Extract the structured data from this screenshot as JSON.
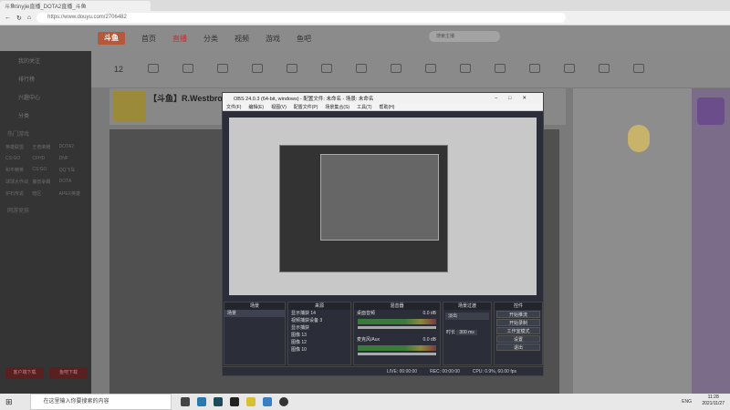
{
  "browser": {
    "tab_active": "斗鱼tinyjie直播_DOTA2直播_斗鱼",
    "url": "https://www.douyu.com/2706482"
  },
  "site": {
    "logo": "斗鱼",
    "nav": [
      "首页",
      "直播",
      "分类",
      "视频",
      "游戏",
      "鱼吧"
    ],
    "search_placeholder": "搜索主播"
  },
  "sidebar": {
    "items": [
      "我的关注",
      "排行榜",
      "兴趣中心",
      "分类"
    ],
    "section1": "热门游戏",
    "games": [
      "英雄联盟",
      "王者荣耀",
      "DOTA2",
      "CS:GO",
      "CFHD",
      "DNF",
      "和平精英",
      "CS:GO",
      "QQ飞车",
      "球球大作战",
      "魔兽争霸",
      "DOTA",
      "炉石传说",
      "暗区",
      "APEX英雄"
    ],
    "section2": "网游竞技",
    "buttons": [
      "客户端下载",
      "鱼吧下载"
    ]
  },
  "room": {
    "streamer": "【斗鱼】R.Westbrook",
    "follow_count": "12"
  },
  "obs": {
    "title": "OBS 24.0.3 (64-bit, windows) - 配置文件: 未命名 - 场景: 未命名",
    "menu": [
      "文件(F)",
      "编辑(E)",
      "视图(V)",
      "配置文件(P)",
      "场景集合(S)",
      "工具(T)",
      "帮助(H)"
    ],
    "docks": {
      "scenes": {
        "title": "场景",
        "items": [
          "场景"
        ]
      },
      "sources": {
        "title": "来源",
        "items": [
          "显示捕获 14",
          "视频捕获设备 3",
          "显示捕获",
          "图像 13",
          "图像 12",
          "图像 10"
        ]
      },
      "mixer": {
        "title": "混音器",
        "channels": [
          {
            "name": "桌面音频",
            "db": "0.0 dB"
          },
          {
            "name": "麦克风/Aux",
            "db": "0.0 dB"
          }
        ]
      },
      "transitions": {
        "title": "场景过渡",
        "type": "淡出",
        "duration_label": "时长",
        "duration": "300 ms"
      },
      "controls": {
        "title": "控件",
        "buttons": [
          "开始推流",
          "开始录制",
          "工作室模式",
          "设置",
          "退出"
        ]
      }
    },
    "status": {
      "live": "LIVE: 00:00:00",
      "rec": "REC: 00:00:00",
      "cpu": "CPU: 0.9%, 60.00 fps"
    }
  },
  "taskbar": {
    "search": "在这里输入你要搜索的内容",
    "time": "11:28",
    "date": "2021/11/27",
    "lang": "ENG"
  }
}
